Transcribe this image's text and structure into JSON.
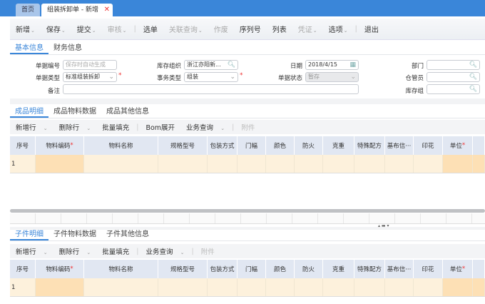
{
  "tabs": {
    "home": "首页",
    "current": "组装拆卸单 - 新增",
    "close": "✕"
  },
  "toolbar": [
    {
      "label": "新增",
      "chev": true,
      "dis": false
    },
    {
      "label": "保存",
      "chev": true,
      "dis": false
    },
    {
      "label": "提交",
      "chev": true,
      "dis": false
    },
    {
      "label": "审核",
      "chev": true,
      "dis": true,
      "sep": true
    },
    {
      "label": "选单",
      "dis": false
    },
    {
      "label": "关联查询",
      "chev": true,
      "dis": true
    },
    {
      "label": "作废",
      "dis": true
    },
    {
      "label": "序列号",
      "dis": false
    },
    {
      "label": "列表",
      "dis": false
    },
    {
      "label": "凭证",
      "chev": true,
      "dis": true
    },
    {
      "label": "选项",
      "chev": true,
      "dis": false,
      "sep": true
    },
    {
      "label": "退出",
      "dis": false
    }
  ],
  "form_tabs": [
    "基本信息",
    "财务信息"
  ],
  "form": {
    "bill_no_label": "单据编号",
    "bill_no_placeholder": "保存时自动生成",
    "bill_type_label": "单据类型",
    "bill_type_value": "标准组装拆卸",
    "remark_label": "备注",
    "stock_org_label": "库存组织",
    "stock_org_value": "浙江亦阳新...",
    "biz_type_label": "事务类型",
    "biz_type_value": "组装",
    "date_label": "日期",
    "date_value": "2018/4/15",
    "status_label": "单据状态",
    "status_value": "暂存",
    "dept_label": "部门",
    "keeper_label": "仓管员",
    "stock_group_label": "库存组"
  },
  "grid_columns": [
    "序号",
    "物料编码",
    "物料名称",
    "规格型号",
    "包装方式",
    "门幅",
    "颜色",
    "防火",
    "克重",
    "特殊配方",
    "基布信···",
    "印花",
    "单位"
  ],
  "grid_row": [
    "1"
  ],
  "product": {
    "tabs": [
      "成品明细",
      "成品物料数据",
      "成品其他信息"
    ],
    "buttons": [
      {
        "label": "新增行",
        "chev": true
      },
      {
        "label": "删除行",
        "chev": true
      },
      {
        "label": "批量填充"
      },
      {
        "label": "Bom展开",
        "sep": true
      },
      {
        "label": "业务查询",
        "chev": true
      },
      {
        "label": "附件",
        "dis": true,
        "sep": true
      }
    ]
  },
  "component": {
    "tabs": [
      "子件明细",
      "子件物料数据",
      "子件其他信息"
    ],
    "buttons": [
      {
        "label": "新增行",
        "chev": true
      },
      {
        "label": "删除行",
        "chev": true
      },
      {
        "label": "批量填充"
      },
      {
        "label": "业务查询",
        "chev": true,
        "sep": true
      },
      {
        "label": "附件",
        "dis": true,
        "sep": true
      }
    ]
  },
  "colors": {
    "accent": "#3a86d9",
    "required": "#e33333",
    "row": "#fdf1dc",
    "row_required": "#fde0b5",
    "header": "#e1e7f2"
  }
}
